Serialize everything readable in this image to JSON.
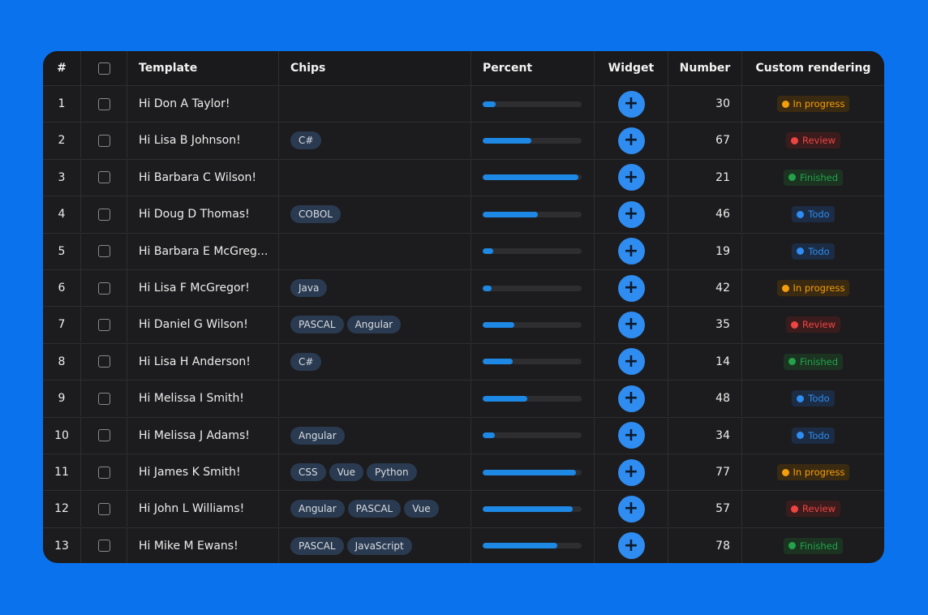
{
  "columns": {
    "idx": "#",
    "template": "Template",
    "chips": "Chips",
    "percent": "Percent",
    "widget": "Widget",
    "number": "Number",
    "custom": "Custom rendering"
  },
  "widget_icon": "plus-icon",
  "status_styles": {
    "In progress": {
      "color": "#f59e0b",
      "bg": "#3a2a12"
    },
    "Review": {
      "color": "#ef4444",
      "bg": "#3a1c1c"
    },
    "Finished": {
      "color": "#22a34a",
      "bg": "#1c3322"
    },
    "Todo": {
      "color": "#2f8cf0",
      "bg": "#1b2c44"
    }
  },
  "rows": [
    {
      "idx": "1",
      "template": "Hi Don A Taylor!",
      "chips": [],
      "percent": 0.13,
      "number": "30",
      "status": "In progress"
    },
    {
      "idx": "2",
      "template": "Hi Lisa B Johnson!",
      "chips": [
        "C#"
      ],
      "percent": 0.49,
      "number": "67",
      "status": "Review"
    },
    {
      "idx": "3",
      "template": "Hi Barbara C Wilson!",
      "chips": [],
      "percent": 0.97,
      "number": "21",
      "status": "Finished"
    },
    {
      "idx": "4",
      "template": "Hi Doug D Thomas!",
      "chips": [
        "COBOL"
      ],
      "percent": 0.56,
      "number": "46",
      "status": "Todo"
    },
    {
      "idx": "5",
      "template": "Hi Barbara E McGreg...",
      "chips": [],
      "percent": 0.11,
      "number": "19",
      "status": "Todo"
    },
    {
      "idx": "6",
      "template": "Hi Lisa F McGregor!",
      "chips": [
        "Java"
      ],
      "percent": 0.09,
      "number": "42",
      "status": "In progress"
    },
    {
      "idx": "7",
      "template": "Hi Daniel G Wilson!",
      "chips": [
        "PASCAL",
        "Angular"
      ],
      "percent": 0.32,
      "number": "35",
      "status": "Review"
    },
    {
      "idx": "8",
      "template": "Hi Lisa H Anderson!",
      "chips": [
        "C#"
      ],
      "percent": 0.3,
      "number": "14",
      "status": "Finished"
    },
    {
      "idx": "9",
      "template": "Hi Melissa I Smith!",
      "chips": [],
      "percent": 0.45,
      "number": "48",
      "status": "Todo"
    },
    {
      "idx": "10",
      "template": "Hi Melissa J Adams!",
      "chips": [
        "Angular"
      ],
      "percent": 0.12,
      "number": "34",
      "status": "Todo"
    },
    {
      "idx": "11",
      "template": "Hi James K Smith!",
      "chips": [
        "CSS",
        "Vue",
        "Python"
      ],
      "percent": 0.94,
      "number": "77",
      "status": "In progress"
    },
    {
      "idx": "12",
      "template": "Hi John L Williams!",
      "chips": [
        "Angular",
        "PASCAL",
        "Vue"
      ],
      "percent": 0.91,
      "number": "57",
      "status": "Review"
    },
    {
      "idx": "13",
      "template": "Hi Mike M Ewans!",
      "chips": [
        "PASCAL",
        "JavaScript"
      ],
      "percent": 0.75,
      "number": "78",
      "status": "Finished"
    }
  ]
}
